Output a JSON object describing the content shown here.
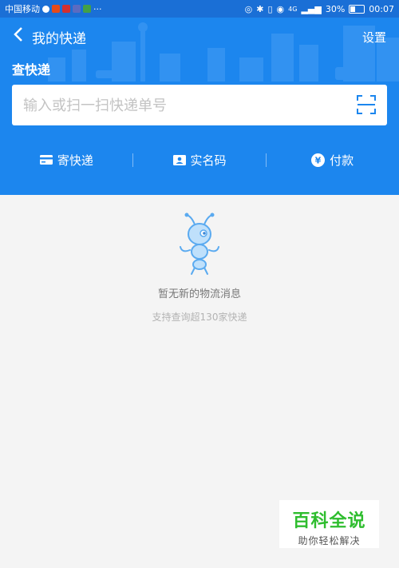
{
  "status_bar": {
    "carrier": "中国移动",
    "more": "···",
    "signal": "4G",
    "battery": "30%",
    "time": "00:07"
  },
  "header": {
    "title": "我的快递",
    "settings": "设置",
    "section": "查快递"
  },
  "search": {
    "placeholder": "输入或扫一扫快递单号"
  },
  "actions": [
    {
      "label": "寄快递",
      "icon": "card-icon"
    },
    {
      "label": "实名码",
      "icon": "id-card-icon"
    },
    {
      "label": "付款",
      "icon": "yuan-icon"
    }
  ],
  "empty_state": {
    "title": "暂无新的物流消息",
    "subtitle": "支持查询超130家快递"
  },
  "watermark": {
    "title": "百科全说",
    "subtitle": "助你轻松解决"
  },
  "colors": {
    "brand_blue": "#1c86ee",
    "status_blue": "#1a6fd6",
    "watermark_green": "#2ebd2e"
  }
}
